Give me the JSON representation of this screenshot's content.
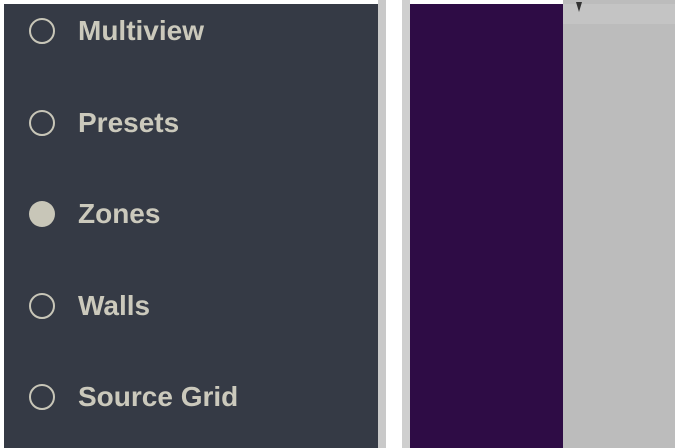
{
  "sidebar": {
    "items": [
      {
        "label": "Multiview",
        "selected": false
      },
      {
        "label": "Presets",
        "selected": false
      },
      {
        "label": "Zones",
        "selected": true
      },
      {
        "label": "Walls",
        "selected": false
      },
      {
        "label": "Source Grid",
        "selected": false
      }
    ]
  },
  "colors": {
    "sidebar_bg": "#353a45",
    "radio_color": "#c8c6b8",
    "label_color": "#cbc9bc",
    "purple_panel": "#2e0c45",
    "gray_panel": "#bcbcbc"
  }
}
